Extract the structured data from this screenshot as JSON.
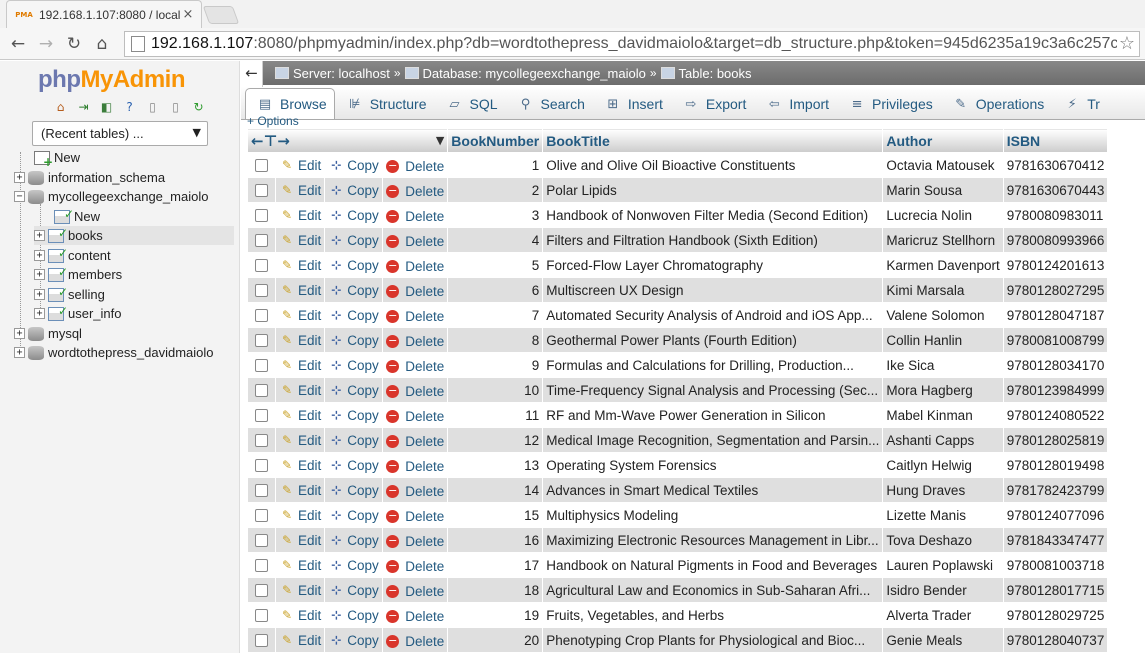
{
  "browser": {
    "tab_title": "192.168.1.107:8080 / local",
    "tab_close": "×",
    "favicon_text": "PMA",
    "url_host": "192.168.1.107",
    "url_rest": ":8080/phpmyadmin/index.php?db=wordtothepress_davidmaiolo&target=db_structure.php&token=945d6235a19c3a6c257c",
    "nav": {
      "back": "←",
      "forward": "→",
      "reload": "↻",
      "home": "⌂",
      "bookmark": "☆"
    }
  },
  "sidebar": {
    "logo_php": "php",
    "logo_myadmin": "MyAdmin",
    "recent_tables": "(Recent tables) ...",
    "tree": {
      "new": "New",
      "information_schema": "information_schema",
      "mycollegeexchange_maiolo": "mycollegeexchange_maiolo",
      "db_new": "New",
      "books": "books",
      "content": "content",
      "members": "members",
      "selling": "selling",
      "user_info": "user_info",
      "mysql": "mysql",
      "wordtothepress_davidmaiolo": "wordtothepress_davidmaiolo"
    }
  },
  "breadcrumb": {
    "server": "Server: localhost",
    "database": "Database: mycollegeexchange_maiolo",
    "table": "Table: books",
    "separator": "»"
  },
  "menu": {
    "tabs": [
      "Browse",
      "Structure",
      "SQL",
      "Search",
      "Insert",
      "Export",
      "Import",
      "Privileges",
      "Operations",
      "Tr"
    ],
    "active": "Browse"
  },
  "options_label": "+ Options",
  "table": {
    "columns": [
      "BookNumber",
      "BookTitle",
      "Author",
      "ISBN"
    ],
    "actions": {
      "edit": "Edit",
      "copy": "Copy",
      "delete": "Delete"
    },
    "rows": [
      {
        "num": "1",
        "title": "Olive and Olive Oil Bioactive Constituents",
        "author": "Octavia Matousek",
        "isbn": "9781630670412"
      },
      {
        "num": "2",
        "title": "Polar Lipids",
        "author": "Marin Sousa",
        "isbn": "9781630670443"
      },
      {
        "num": "3",
        "title": "Handbook of Nonwoven Filter Media (Second Edition)",
        "author": "Lucrecia Nolin",
        "isbn": "9780080983011"
      },
      {
        "num": "4",
        "title": "Filters and Filtration Handbook (Sixth Edition)",
        "author": "Maricruz Stellhorn",
        "isbn": "9780080993966"
      },
      {
        "num": "5",
        "title": "Forced-Flow Layer Chromatography",
        "author": "Karmen Davenport",
        "isbn": "9780124201613"
      },
      {
        "num": "6",
        "title": "Multiscreen UX Design",
        "author": "Kimi Marsala",
        "isbn": "9780128027295"
      },
      {
        "num": "7",
        "title": "Automated Security Analysis of Android and iOS App...",
        "author": "Valene Solomon",
        "isbn": "9780128047187"
      },
      {
        "num": "8",
        "title": "Geothermal Power Plants (Fourth Edition)",
        "author": "Collin Hanlin",
        "isbn": "9780081008799"
      },
      {
        "num": "9",
        "title": "Formulas and Calculations for Drilling, Production...",
        "author": "Ike Sica",
        "isbn": "9780128034170"
      },
      {
        "num": "10",
        "title": "Time-Frequency Signal Analysis and Processing (Sec...",
        "author": "Mora Hagberg",
        "isbn": "9780123984999"
      },
      {
        "num": "11",
        "title": "RF and Mm-Wave Power Generation in Silicon",
        "author": "Mabel Kinman",
        "isbn": "9780124080522"
      },
      {
        "num": "12",
        "title": "Medical Image Recognition, Segmentation and Parsin...",
        "author": "Ashanti Capps",
        "isbn": "9780128025819"
      },
      {
        "num": "13",
        "title": "Operating System Forensics",
        "author": "Caitlyn Helwig",
        "isbn": "9780128019498"
      },
      {
        "num": "14",
        "title": "Advances in Smart Medical Textiles",
        "author": "Hung Draves",
        "isbn": "9781782423799"
      },
      {
        "num": "15",
        "title": "Multiphysics Modeling",
        "author": "Lizette Manis",
        "isbn": "9780124077096"
      },
      {
        "num": "16",
        "title": "Maximizing Electronic Resources Management in Libr...",
        "author": "Tova Deshazo",
        "isbn": "9781843347477"
      },
      {
        "num": "17",
        "title": "Handbook on Natural Pigments in Food and Beverages",
        "author": "Lauren Poplawski",
        "isbn": "9780081003718"
      },
      {
        "num": "18",
        "title": "Agricultural Law and Economics in Sub-Saharan Afri...",
        "author": "Isidro Bender",
        "isbn": "9780128017715"
      },
      {
        "num": "19",
        "title": "Fruits, Vegetables, and Herbs",
        "author": "Alverta Trader",
        "isbn": "9780128029725"
      },
      {
        "num": "20",
        "title": "Phenotyping Crop Plants for Physiological and Bioc...",
        "author": "Genie Meals",
        "isbn": "9780128040737"
      }
    ]
  }
}
